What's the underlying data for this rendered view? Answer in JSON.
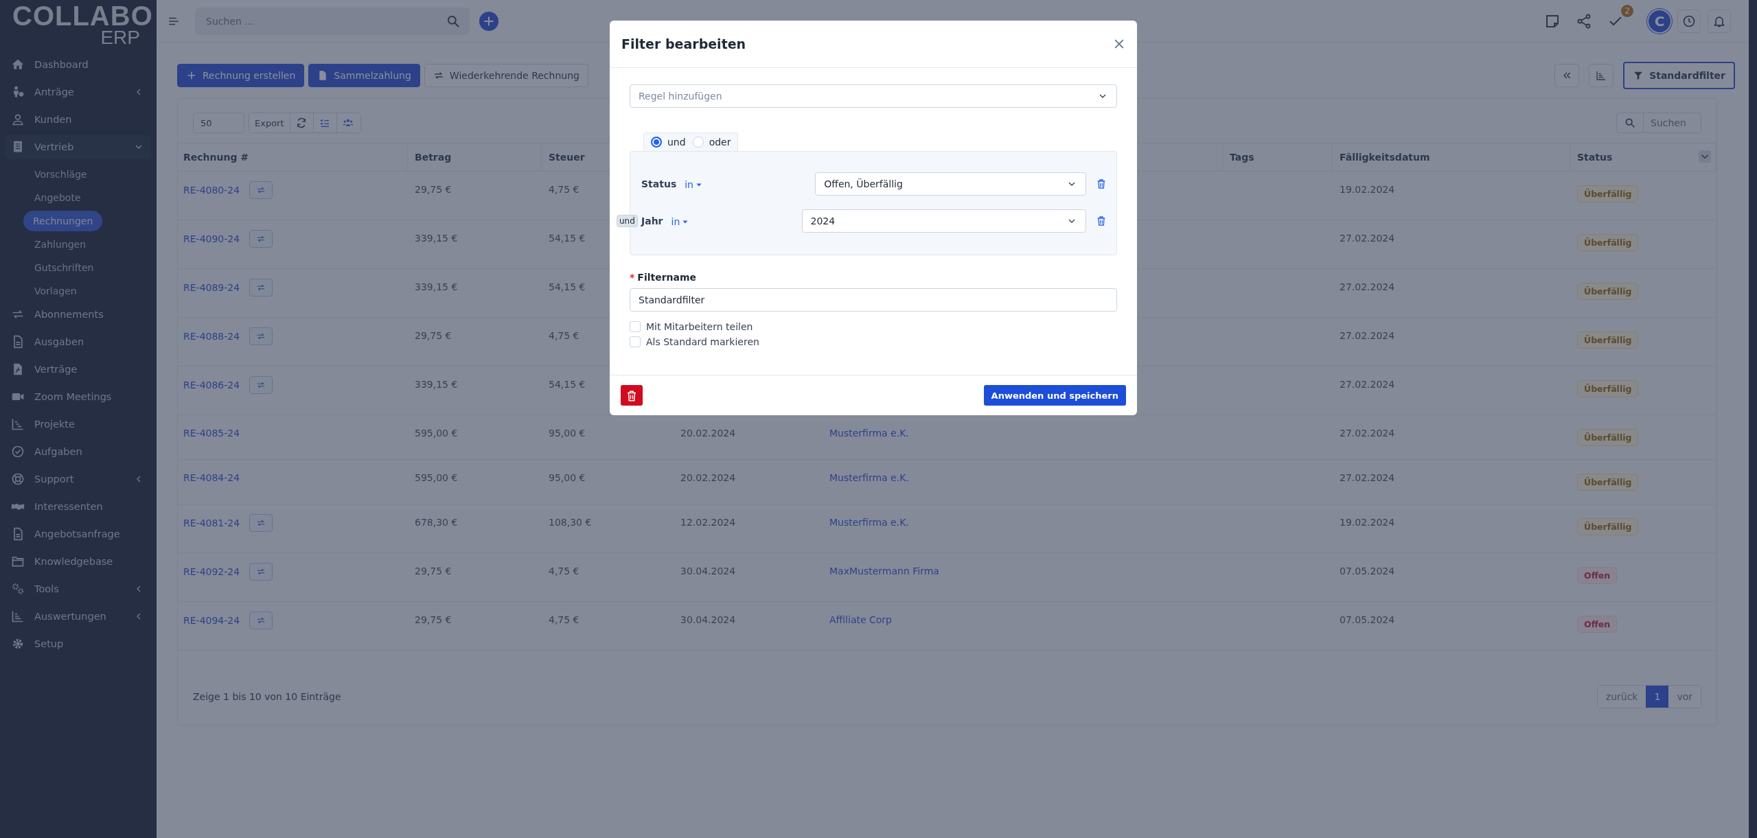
{
  "logo": {
    "name": "COLLABO",
    "sub": "ERP"
  },
  "sidebar": {
    "items": [
      {
        "label": "Dashboard",
        "expandable": false
      },
      {
        "label": "Anträge",
        "expandable": true,
        "expanded": false
      },
      {
        "label": "Kunden",
        "expandable": false
      },
      {
        "label": "Vertrieb",
        "expandable": true,
        "expanded": true,
        "children": [
          {
            "label": "Vorschläge",
            "selected": false
          },
          {
            "label": "Angebote",
            "selected": false
          },
          {
            "label": "Rechnungen",
            "selected": true
          },
          {
            "label": "Zahlungen",
            "selected": false
          },
          {
            "label": "Gutschriften",
            "selected": false
          },
          {
            "label": "Vorlagen",
            "selected": false
          }
        ]
      },
      {
        "label": "Abonnements",
        "expandable": false
      },
      {
        "label": "Ausgaben",
        "expandable": false
      },
      {
        "label": "Verträge",
        "expandable": false
      },
      {
        "label": "Zoom Meetings",
        "expandable": false
      },
      {
        "label": "Projekte",
        "expandable": false
      },
      {
        "label": "Aufgaben",
        "expandable": false
      },
      {
        "label": "Support",
        "expandable": true,
        "expanded": false
      },
      {
        "label": "Interessenten",
        "expandable": false
      },
      {
        "label": "Angebotsanfrage",
        "expandable": false
      },
      {
        "label": "Knowledgebase",
        "expandable": false
      },
      {
        "label": "Tools",
        "expandable": true,
        "expanded": false
      },
      {
        "label": "Auswertungen",
        "expandable": true,
        "expanded": false
      },
      {
        "label": "Setup",
        "expandable": false
      }
    ]
  },
  "topbar": {
    "search": {
      "placeholder": "Suchen ..."
    },
    "task_badge": "2",
    "avatar": "C"
  },
  "toolbar": {
    "buttons": [
      {
        "label": "Rechnung erstellen",
        "kind": "primary"
      },
      {
        "label": "Sammelzahlung",
        "kind": "primary"
      },
      {
        "label": "Wiederkehrende Rechnung",
        "kind": "outline"
      }
    ],
    "filter_button": "Standardfilter"
  },
  "table_controls": {
    "page_size": "50",
    "export": "Export",
    "search": {
      "placeholder": "Suchen"
    }
  },
  "table": {
    "columns": [
      "Rechnung #",
      "Betrag",
      "Steuer",
      null,
      null,
      "Tags",
      "Fälligkeitsdatum",
      "Status"
    ],
    "rows": [
      {
        "number": "RE-4080-24",
        "recurring": true,
        "amount": "29,75 €",
        "tax": "4,75 €",
        "due": "19.02.2024",
        "status": {
          "label": "Überfällig",
          "kind": "overdue"
        }
      },
      {
        "number": "RE-4090-24",
        "recurring": true,
        "amount": "339,15 €",
        "tax": "54,15 €",
        "due": "27.02.2024",
        "status": {
          "label": "Überfällig",
          "kind": "overdue"
        }
      },
      {
        "number": "RE-4089-24",
        "recurring": true,
        "amount": "339,15 €",
        "tax": "54,15 €",
        "due": "27.02.2024",
        "status": {
          "label": "Überfällig",
          "kind": "overdue"
        }
      },
      {
        "number": "RE-4088-24",
        "recurring": true,
        "amount": "29,75 €",
        "tax": "4,75 €",
        "due": "27.02.2024",
        "status": {
          "label": "Überfällig",
          "kind": "overdue"
        }
      },
      {
        "number": "RE-4086-24",
        "recurring": true,
        "amount": "339,15 €",
        "tax": "54,15 €",
        "due": "27.02.2024",
        "status": {
          "label": "Überfällig",
          "kind": "overdue"
        }
      },
      {
        "number": "RE-4085-24",
        "recurring": false,
        "amount": "595,00 €",
        "tax": "95,00 €",
        "date": "20.02.2024",
        "customer": "Musterfirma e.K.",
        "due": "27.02.2024",
        "status": {
          "label": "Überfällig",
          "kind": "overdue"
        }
      },
      {
        "number": "RE-4084-24",
        "recurring": false,
        "amount": "595,00 €",
        "tax": "95,00 €",
        "date": "20.02.2024",
        "customer": "Musterfirma e.K.",
        "due": "27.02.2024",
        "status": {
          "label": "Überfällig",
          "kind": "overdue"
        }
      },
      {
        "number": "RE-4081-24",
        "recurring": true,
        "amount": "678,30 €",
        "tax": "108,30 €",
        "date": "12.02.2024",
        "customer": "Musterfirma e.K.",
        "due": "19.02.2024",
        "status": {
          "label": "Überfällig",
          "kind": "overdue"
        }
      },
      {
        "number": "RE-4092-24",
        "recurring": true,
        "amount": "29,75 €",
        "tax": "4,75 €",
        "date": "30.04.2024",
        "customer": "MaxMustermann Firma",
        "due": "07.05.2024",
        "status": {
          "label": "Offen",
          "kind": "open"
        }
      },
      {
        "number": "RE-4094-24",
        "recurring": true,
        "amount": "29,75 €",
        "tax": "4,75 €",
        "date": "30.04.2024",
        "customer": "Affiliate Corp",
        "due": "07.05.2024",
        "status": {
          "label": "Offen",
          "kind": "open"
        }
      }
    ]
  },
  "table_footer": {
    "info": "Zeige 1 bis 10 von 10 Einträge",
    "pagination": [
      {
        "label": "zurück",
        "selected": false
      },
      {
        "label": "1",
        "selected": true
      },
      {
        "label": "vor",
        "selected": false
      }
    ]
  },
  "modal": {
    "title": "Filter bearbeiten",
    "rule_select": {
      "placeholder": "Regel hinzufügen"
    },
    "logic": [
      {
        "label": "und",
        "selected": true
      },
      {
        "label": "oder",
        "selected": false
      }
    ],
    "rules": [
      {
        "field": "Status",
        "operator": "in",
        "value": "Offen, Überfällig"
      },
      {
        "connector": "und",
        "field": "Jahr",
        "operator": "in",
        "value": "2024"
      }
    ],
    "filter_name": {
      "label": "Filtername",
      "required_mark": "*",
      "value": "Standardfilter"
    },
    "checkboxes": [
      {
        "label": "Mit Mitarbeitern teilen",
        "checked": false
      },
      {
        "label": "Als Standard markieren",
        "checked": false
      }
    ],
    "save_button": "Anwenden und speichern"
  }
}
